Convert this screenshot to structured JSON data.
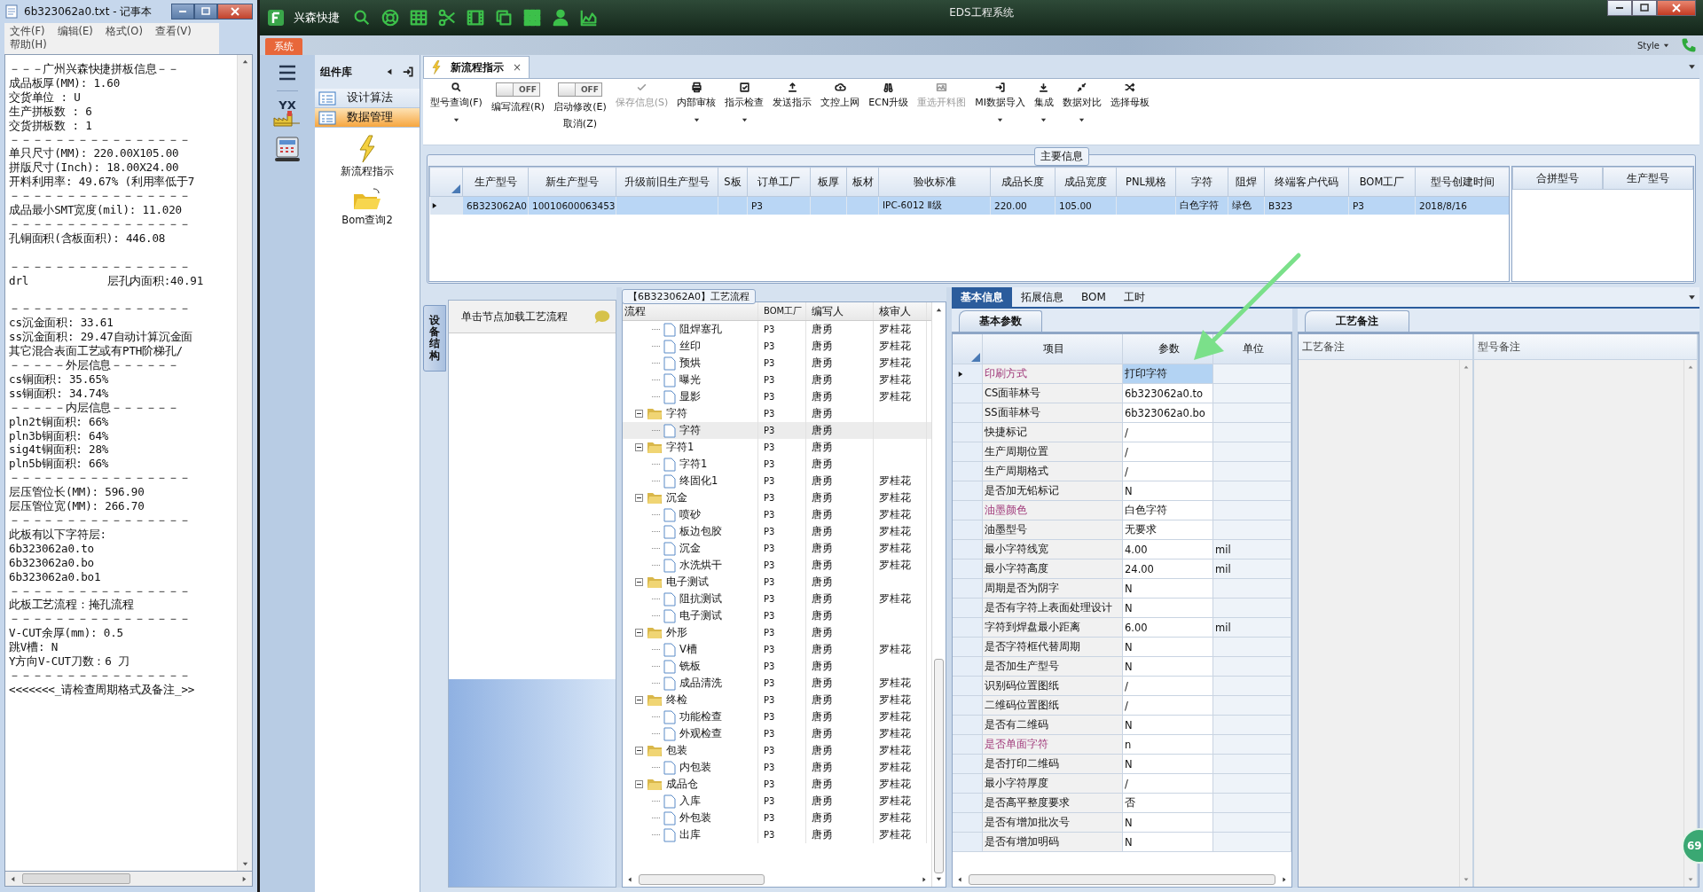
{
  "notepad": {
    "title": "6b323062a0.txt - 记事本",
    "menu": [
      "文件(F)",
      "编辑(E)",
      "格式(O)",
      "查看(V)",
      "帮助(H)"
    ],
    "lines": [
      {
        "text": "－－－广州兴森快捷拼板信息－－"
      },
      {
        "text": "成品板厚(MM): 1.60"
      },
      {
        "text": "交货单位 : U"
      },
      {
        "text": "生产拼板数 : 6"
      },
      {
        "text": "交货拼板数 : 1"
      },
      {
        "text": "－－－－－－－－－－－－－－－－"
      },
      {
        "text": "单只尺寸(MM): 220.00X105.00"
      },
      {
        "text": "拼版尺寸(Inch): 18.00X24.00"
      },
      {
        "text": "开料利用率: 49.67% (利用率低于7"
      },
      {
        "text": "－－－－－－－－－－－－－－－－"
      },
      {
        "text": "成品最小SMT宽度(mil): 11.020"
      },
      {
        "text": "－－－－－－－－－－－－－－－－"
      },
      {
        "text": "孔铜面积(含板面积): 446.08"
      },
      {
        "text": "－－－－－－－－－－－－－－－－",
        "space_before": true
      },
      {
        "text": "drl            层孔内面积:40.91"
      },
      {
        "text": "－－－－－－－－－－－－－－－－",
        "space_before": true
      },
      {
        "text": "cs沉金面积: 33.61"
      },
      {
        "text": "ss沉金面积: 29.47自动计算沉金面"
      },
      {
        "text": "其它混合表面工艺或有PTH阶梯孔/"
      },
      {
        "text": "－－－－－外层信息－－－－－－"
      },
      {
        "text": "cs铜面积: 35.65%"
      },
      {
        "text": "ss铜面积: 34.74%"
      },
      {
        "text": "－－－－－内层信息－－－－－－"
      },
      {
        "text": "pln2t铜面积: 66%"
      },
      {
        "text": "pln3b铜面积: 64%"
      },
      {
        "text": "sig4t铜面积: 28%"
      },
      {
        "text": "pln5b铜面积: 66%"
      },
      {
        "text": "－－－－－－－－－－－－－－－－"
      },
      {
        "text": "层压管位长(MM): 596.90"
      },
      {
        "text": "层压管位宽(MM): 266.70"
      },
      {
        "text": "－－－－－－－－－－－－－－－－"
      },
      {
        "text": "此板有以下字符层:"
      },
      {
        "text": "6b323062a0.to"
      },
      {
        "text": "6b323062a0.bo"
      },
      {
        "text": "6b323062a0.bo1"
      },
      {
        "text": "－－－－－－－－－－－－－－－－"
      },
      {
        "text": "此板工艺流程：掩孔流程"
      },
      {
        "text": "－－－－－－－－－－－－－－－－"
      },
      {
        "text": "V-CUT余厚(mm): 0.5"
      },
      {
        "text": "跳V槽: N"
      },
      {
        "text": "Y方向V-CUT刀数：6 刀"
      },
      {
        "text": "－－－－－－－－－－－－－－－－"
      },
      {
        "text": "<<<<<<<_请检查周期格式及备注_>>"
      }
    ]
  },
  "app": {
    "brand": "兴森快捷",
    "title": "EDS工程系统",
    "ribbon_tab": "系统",
    "style_menu": "Style"
  },
  "sidebar": {
    "logo_text": "YX"
  },
  "library": {
    "title": "组件库",
    "categories": [
      {
        "label": "设计算法",
        "selected": false
      },
      {
        "label": "数据管理",
        "selected": true
      }
    ],
    "tiles": [
      {
        "label": "新流程指示"
      },
      {
        "label": "Bom查询2"
      }
    ]
  },
  "document_tab": {
    "label": "新流程指示",
    "close": "×"
  },
  "toolbar": [
    {
      "kind": "button",
      "label": "型号查询(F)",
      "disabled": false,
      "dropdown": true
    },
    {
      "kind": "toggle",
      "label": "编写流程(R)",
      "toggle_text": "OFF",
      "on": false
    },
    {
      "kind": "toggle",
      "label": "启动修改(E)",
      "sublabel": "取消(Z)",
      "toggle_text": "OFF",
      "on": false
    },
    {
      "kind": "button",
      "label": "保存信息(S)",
      "disabled": true,
      "dropdown": false
    },
    {
      "kind": "button",
      "label": "内部审核",
      "disabled": false,
      "dropdown": true
    },
    {
      "kind": "button",
      "label": "指示检查",
      "disabled": false,
      "dropdown": true
    },
    {
      "kind": "button",
      "label": "发送指示",
      "disabled": false,
      "dropdown": false
    },
    {
      "kind": "button",
      "label": "文控上网",
      "disabled": false,
      "dropdown": false
    },
    {
      "kind": "button",
      "label": "ECN升级",
      "disabled": false,
      "dropdown": false
    },
    {
      "kind": "button",
      "label": "重选开料图",
      "disabled": true,
      "dropdown": false
    },
    {
      "kind": "button",
      "label": "MI数据导入",
      "disabled": false,
      "dropdown": true
    },
    {
      "kind": "button",
      "label": "集成",
      "disabled": false,
      "dropdown": true
    },
    {
      "kind": "button",
      "label": "数据对比",
      "disabled": false,
      "dropdown": true
    },
    {
      "kind": "button",
      "label": "选择母板",
      "disabled": false,
      "dropdown": false
    }
  ],
  "main_info": {
    "title": "主要信息",
    "columns": [
      "生产型号",
      "新生产型号",
      "升级前旧生产型号",
      "S板",
      "订单工厂",
      "板厚",
      "板材",
      "验收标准",
      "成品长度",
      "成品宽度",
      "PNL规格",
      "字符",
      "阻焊",
      "终端客户代码",
      "BOM工厂",
      "型号创建时间"
    ],
    "rows": [
      {
        "selected": true,
        "cells": [
          "6B323062A0",
          "10010600063453",
          null,
          null,
          "P3",
          null,
          null,
          "IPC-6012 Ⅱ级",
          "220.00",
          "105.00",
          null,
          "白色字符",
          "绿色",
          "B323",
          "P3",
          "2018/8/16"
        ]
      }
    ],
    "side_columns": [
      "合拼型号",
      "生产型号"
    ]
  },
  "process": {
    "side_tab": "设备结构",
    "hint": "单击节点加载工艺流程",
    "title": "【6B323062A0】工艺流程",
    "columns": [
      "流程",
      "BOM工厂",
      "编写人",
      "核审人"
    ],
    "nodes": [
      {
        "children": [
          {
            "label": "阻焊塞孔",
            "factory": "P3",
            "writer": "唐勇",
            "reviewer": "罗桂花",
            "selected": false
          },
          {
            "label": "丝印",
            "factory": "P3",
            "writer": "唐勇",
            "reviewer": "罗桂花",
            "selected": false
          },
          {
            "label": "预烘",
            "factory": "P3",
            "writer": "唐勇",
            "reviewer": "罗桂花",
            "selected": false
          },
          {
            "label": "曝光",
            "factory": "P3",
            "writer": "唐勇",
            "reviewer": "罗桂花",
            "selected": false
          },
          {
            "label": "显影",
            "factory": "P3",
            "writer": "唐勇",
            "reviewer": "罗桂花",
            "selected": false
          }
        ]
      },
      {
        "label": "字符",
        "factory": "P3",
        "writer": "唐勇",
        "expanded": true,
        "selected": false,
        "children": [
          {
            "label": "字符",
            "factory": "P3",
            "writer": "唐勇",
            "selected": true
          }
        ]
      },
      {
        "label": "字符1",
        "factory": "P3",
        "writer": "唐勇",
        "expanded": true,
        "selected": false,
        "children": [
          {
            "label": "字符1",
            "factory": "P3",
            "writer": "唐勇",
            "selected": false
          },
          {
            "label": "终固化1",
            "factory": "P3",
            "writer": "唐勇",
            "reviewer": "罗桂花",
            "selected": false
          }
        ]
      },
      {
        "label": "沉金",
        "factory": "P3",
        "writer": "唐勇",
        "reviewer": "罗桂花",
        "expanded": true,
        "selected": false,
        "children": [
          {
            "label": "喷砂",
            "factory": "P3",
            "writer": "唐勇",
            "reviewer": "罗桂花",
            "selected": false
          },
          {
            "label": "板边包胶",
            "factory": "P3",
            "writer": "唐勇",
            "reviewer": "罗桂花",
            "selected": false
          },
          {
            "label": "沉金",
            "factory": "P3",
            "writer": "唐勇",
            "reviewer": "罗桂花",
            "selected": false
          },
          {
            "label": "水洗烘干",
            "factory": "P3",
            "writer": "唐勇",
            "reviewer": "罗桂花",
            "selected": false
          }
        ]
      },
      {
        "label": "电子测试",
        "factory": "P3",
        "writer": "唐勇",
        "expanded": true,
        "selected": false,
        "children": [
          {
            "label": "阻抗测试",
            "factory": "P3",
            "writer": "唐勇",
            "reviewer": "罗桂花",
            "selected": false
          },
          {
            "label": "电子测试",
            "factory": "P3",
            "writer": "唐勇",
            "selected": false
          }
        ]
      },
      {
        "label": "外形",
        "factory": "P3",
        "writer": "唐勇",
        "expanded": true,
        "selected": false,
        "children": [
          {
            "label": "V槽",
            "factory": "P3",
            "writer": "唐勇",
            "reviewer": "罗桂花",
            "selected": false
          },
          {
            "label": "铣板",
            "factory": "P3",
            "writer": "唐勇",
            "selected": false
          },
          {
            "label": "成品清洗",
            "factory": "P3",
            "writer": "唐勇",
            "reviewer": "罗桂花",
            "selected": false
          }
        ]
      },
      {
        "label": "终检",
        "factory": "P3",
        "writer": "唐勇",
        "reviewer": "罗桂花",
        "expanded": true,
        "selected": false,
        "children": [
          {
            "label": "功能检查",
            "factory": "P3",
            "writer": "唐勇",
            "reviewer": "罗桂花",
            "selected": false
          },
          {
            "label": "外观检查",
            "factory": "P3",
            "writer": "唐勇",
            "reviewer": "罗桂花",
            "selected": false
          }
        ]
      },
      {
        "label": "包装",
        "factory": "P3",
        "writer": "唐勇",
        "reviewer": "罗桂花",
        "expanded": true,
        "selected": false,
        "children": [
          {
            "label": "内包装",
            "factory": "P3",
            "writer": "唐勇",
            "reviewer": "罗桂花",
            "selected": false
          }
        ]
      },
      {
        "label": "成品仓",
        "factory": "P3",
        "writer": "唐勇",
        "reviewer": "罗桂花",
        "expanded": true,
        "selected": false,
        "children": [
          {
            "label": "入库",
            "factory": "P3",
            "writer": "唐勇",
            "reviewer": "罗桂花",
            "selected": false
          },
          {
            "label": "外包装",
            "factory": "P3",
            "writer": "唐勇",
            "reviewer": "罗桂花",
            "selected": false
          },
          {
            "label": "出库",
            "factory": "P3",
            "writer": "唐勇",
            "reviewer": "罗桂花",
            "selected": false
          }
        ]
      }
    ]
  },
  "details": {
    "tabs": [
      {
        "label": "基本信息",
        "selected": true
      },
      {
        "label": "拓展信息",
        "selected": false
      },
      {
        "label": "BOM",
        "selected": false
      },
      {
        "label": "工时",
        "selected": false
      }
    ],
    "subtab": "基本参数",
    "columns": [
      "项目",
      "参数",
      "单位"
    ],
    "rows": [
      {
        "name": "印刷方式",
        "value": "打印字符",
        "flagged": true,
        "selected": true
      },
      {
        "name": "CS面菲林号",
        "value": "6b323062a0.to",
        "flagged": false,
        "selected": false
      },
      {
        "name": "SS面菲林号",
        "value": "6b323062a0.bo",
        "flagged": false,
        "selected": false
      },
      {
        "name": "快捷标记",
        "value": "/",
        "flagged": false,
        "selected": false
      },
      {
        "name": "生产周期位置",
        "value": "/",
        "flagged": false,
        "selected": false
      },
      {
        "name": "生产周期格式",
        "value": "/",
        "flagged": false,
        "selected": false
      },
      {
        "name": "是否加无铅标记",
        "value": "N",
        "flagged": false,
        "selected": false
      },
      {
        "name": "油墨颜色",
        "value": "白色字符",
        "flagged": true,
        "selected": false
      },
      {
        "name": "油墨型号",
        "value": "无要求",
        "flagged": false,
        "selected": false
      },
      {
        "name": "最小字符线宽",
        "value": "4.00",
        "unit": "mil",
        "flagged": false,
        "selected": false
      },
      {
        "name": "最小字符高度",
        "value": "24.00",
        "unit": "mil",
        "flagged": false,
        "selected": false
      },
      {
        "name": "周期是否为阴字",
        "value": "N",
        "flagged": false,
        "selected": false
      },
      {
        "name": "是否有字符上表面处理设计",
        "value": "N",
        "flagged": false,
        "selected": false
      },
      {
        "name": "字符到焊盘最小距离",
        "value": "6.00",
        "unit": "mil",
        "flagged": false,
        "selected": false
      },
      {
        "name": "是否字符框代替周期",
        "value": "N",
        "flagged": false,
        "selected": false
      },
      {
        "name": "是否加生产型号",
        "value": "N",
        "flagged": false,
        "selected": false
      },
      {
        "name": "识别码位置图纸",
        "value": "/",
        "flagged": false,
        "selected": false
      },
      {
        "name": "二维码位置图纸",
        "value": "/",
        "flagged": false,
        "selected": false
      },
      {
        "name": "是否有二维码",
        "value": "N",
        "flagged": false,
        "selected": false
      },
      {
        "name": "是否单面字符",
        "value": "n",
        "flagged": true,
        "selected": false
      },
      {
        "name": "是否打印二维码",
        "value": "N",
        "flagged": false,
        "selected": false
      },
      {
        "name": "最小字符厚度",
        "value": "/",
        "flagged": false,
        "selected": false
      },
      {
        "name": "是否高平整度要求",
        "value": "否",
        "flagged": false,
        "selected": false
      },
      {
        "name": "是否有增加批次号",
        "value": "N",
        "flagged": false,
        "selected": false
      },
      {
        "name": "是否有增加明码",
        "value": "N",
        "flagged": false,
        "selected": false
      }
    ]
  },
  "notes": {
    "tab": "工艺备注",
    "columns": [
      "工艺备注",
      "型号备注"
    ]
  },
  "badge": "69"
}
